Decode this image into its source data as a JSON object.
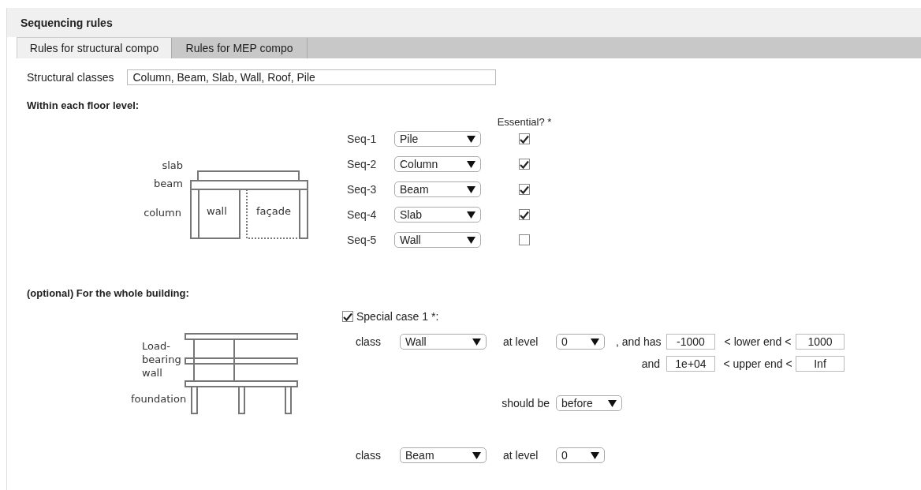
{
  "title": "Sequencing rules",
  "tabs": [
    {
      "label": "Rules for structural compo",
      "selected": true
    },
    {
      "label": "Rules for MEP compo",
      "selected": false
    }
  ],
  "structural_classes": {
    "label": "Structural classes",
    "value": "Column, Beam, Slab, Wall, Roof, Pile"
  },
  "floor_level": {
    "heading": "Within each floor level:",
    "diagram_labels": {
      "slab": "slab",
      "beam": "beam",
      "column": "column",
      "wall": "wall",
      "facade": "façade"
    },
    "essential_header": "Essential? *",
    "rows": [
      {
        "label": "Seq-1",
        "value": "Pile",
        "essential": true
      },
      {
        "label": "Seq-2",
        "value": "Column",
        "essential": true
      },
      {
        "label": "Seq-3",
        "value": "Beam",
        "essential": true
      },
      {
        "label": "Seq-4",
        "value": "Slab",
        "essential": true
      },
      {
        "label": "Seq-5",
        "value": "Wall",
        "essential": false
      }
    ]
  },
  "whole_building": {
    "heading": "(optional) For the whole building:",
    "diagram_labels": {
      "wall": "Load-bearing wall",
      "foundation": "foundation"
    },
    "special_case": {
      "label": "Special case 1 *:",
      "checked": true,
      "class_a": {
        "label": "class",
        "value": "Wall"
      },
      "level_a": {
        "label": "at level",
        "value": "0"
      },
      "has_label": ", and has",
      "lower": {
        "min": "-1000",
        "label": "< lower end <",
        "max": "1000"
      },
      "and_label": "and",
      "upper": {
        "min": "1e+04",
        "label": "< upper end <",
        "max": "Inf"
      },
      "order": {
        "label": "should be",
        "value": "before"
      },
      "class_b": {
        "label": "class",
        "value": "Beam"
      },
      "level_b": {
        "label": "at level",
        "value": "0"
      }
    }
  }
}
